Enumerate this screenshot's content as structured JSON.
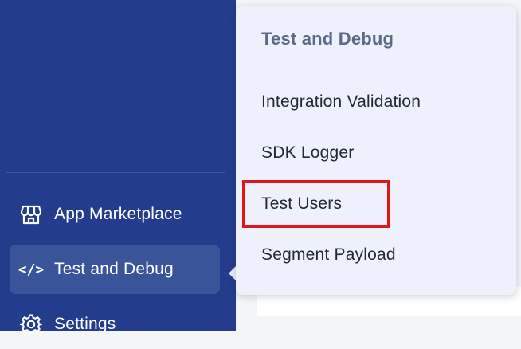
{
  "sidebar": {
    "items": [
      {
        "label": "App Marketplace",
        "icon": "storefront-icon",
        "active": false
      },
      {
        "label": "Test and Debug",
        "icon": "code-icon",
        "active": true
      },
      {
        "label": "Settings",
        "icon": "gear-icon",
        "active": false
      }
    ]
  },
  "flyout": {
    "title": "Test and Debug",
    "items": [
      {
        "label": "Integration Validation"
      },
      {
        "label": "SDK Logger"
      },
      {
        "label": "Test Users",
        "highlighted": true
      },
      {
        "label": "Segment Payload"
      }
    ]
  },
  "colors": {
    "sidebar_bg": "#233d8c",
    "active_item_bg": "#3a5499",
    "flyout_bg": "#eef0fb",
    "highlight": "#e1141b"
  }
}
